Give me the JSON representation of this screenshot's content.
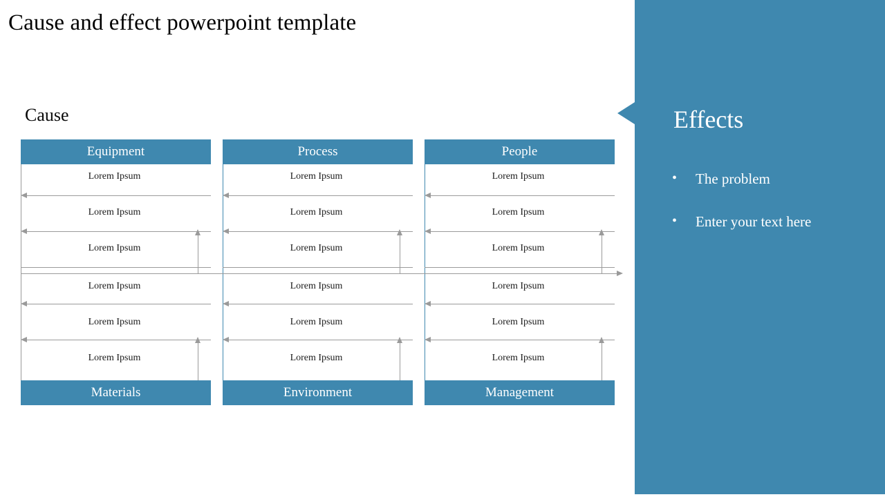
{
  "slide": {
    "title": "Cause and effect powerpoint template",
    "cause_label": "Cause",
    "accent_color": "#3f88af",
    "line_color": "#9a9a9a",
    "text_color": "#1a1a1a"
  },
  "diagram": {
    "columns": [
      {
        "header": "Equipment",
        "footer": "Materials",
        "top_rows": [
          "Lorem Ipsum",
          "Lorem Ipsum",
          "Lorem Ipsum"
        ],
        "bottom_rows": [
          "Lorem Ipsum",
          "Lorem Ipsum",
          "Lorem Ipsum"
        ]
      },
      {
        "header": "Process",
        "footer": "Environment",
        "top_rows": [
          "Lorem Ipsum",
          "Lorem Ipsum",
          "Lorem Ipsum"
        ],
        "bottom_rows": [
          "Lorem Ipsum",
          "Lorem Ipsum",
          "Lorem Ipsum"
        ]
      },
      {
        "header": "People",
        "footer": "Management",
        "top_rows": [
          "Lorem Ipsum",
          "Lorem Ipsum",
          "Lorem Ipsum"
        ],
        "bottom_rows": [
          "Lorem Ipsum",
          "Lorem Ipsum",
          "Lorem Ipsum"
        ]
      }
    ]
  },
  "effects": {
    "title": "Effects",
    "bullets": [
      "The problem",
      "Enter your text here"
    ]
  }
}
